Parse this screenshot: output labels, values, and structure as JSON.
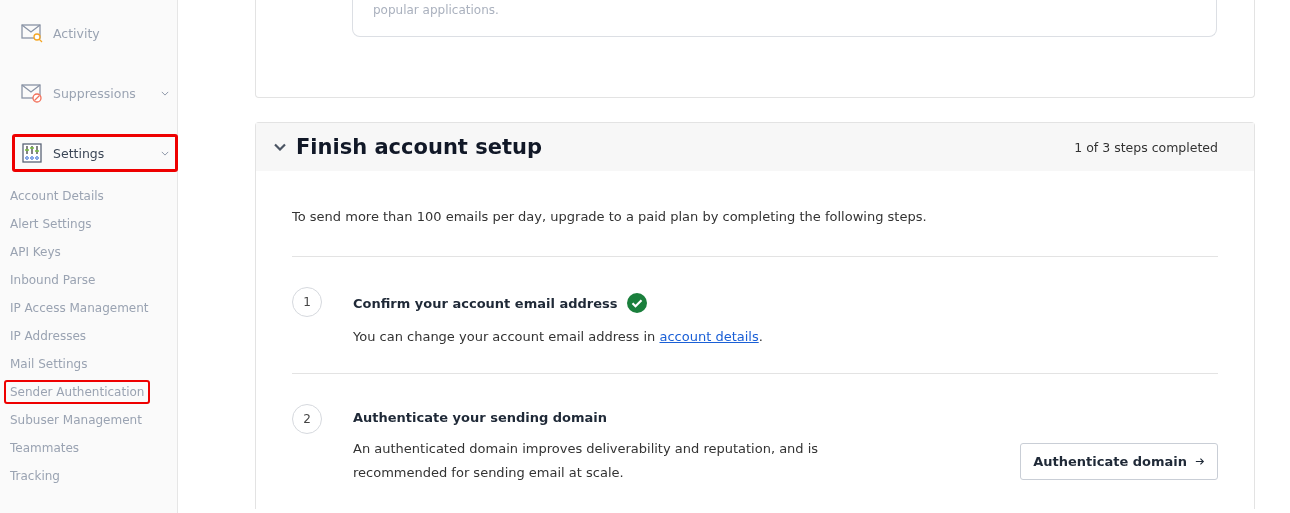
{
  "sidebar": {
    "nav": [
      {
        "label": "Activity",
        "has_chevron": false,
        "highlighted": false
      },
      {
        "label": "Suppressions",
        "has_chevron": true,
        "highlighted": false
      },
      {
        "label": "Settings",
        "has_chevron": true,
        "highlighted": true
      }
    ],
    "subitems": [
      {
        "label": "Account Details",
        "highlighted": false
      },
      {
        "label": "Alert Settings",
        "highlighted": false
      },
      {
        "label": "API Keys",
        "highlighted": false
      },
      {
        "label": "Inbound Parse",
        "highlighted": false
      },
      {
        "label": "IP Access Management",
        "highlighted": false
      },
      {
        "label": "IP Addresses",
        "highlighted": false
      },
      {
        "label": "Mail Settings",
        "highlighted": false
      },
      {
        "label": "Sender Authentication",
        "highlighted": true
      },
      {
        "label": "Subuser Management",
        "highlighted": false
      },
      {
        "label": "Teammates",
        "highlighted": false
      },
      {
        "label": "Tracking",
        "highlighted": false
      }
    ]
  },
  "top_card": {
    "text": "popular applications."
  },
  "setup": {
    "title": "Finish account setup",
    "expanded": true,
    "progress": "1 of 3 steps completed",
    "intro": "To send more than 100 emails per day, upgrade to a paid plan by completing the following steps.",
    "steps": [
      {
        "number": "1",
        "title": "Confirm your account email address",
        "completed": true,
        "text": "You can change your account email address in ",
        "link": "account details",
        "text_after": "."
      },
      {
        "number": "2",
        "title": "Authenticate your sending domain",
        "completed": false,
        "text": "An authenticated domain improves deliverability and reputation, and is recommended for sending email at scale.",
        "button": "Authenticate domain"
      }
    ]
  }
}
